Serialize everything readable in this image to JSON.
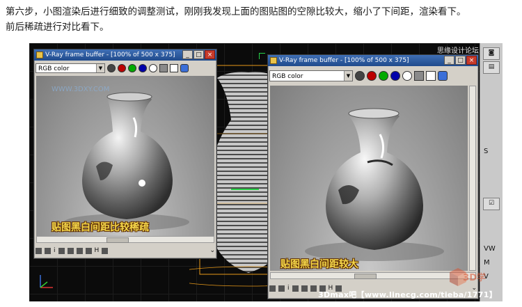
{
  "article": {
    "line1": "第六步，小图渲染后进行细致的调整测试，刚刚我发现上面的图贴图的空隙比较大，缩小了下间距，渲染看下。",
    "line2": "前后稀疏进行对比看下。"
  },
  "vray_left": {
    "title": "V-Ray frame buffer - [100% of 500 x 375]",
    "channel": "RGB color",
    "caption": "贴图黑白间距比较稀疏"
  },
  "vray_right": {
    "title": "V-Ray frame buffer - [100% of 500 x 375]",
    "channel": "RGB color",
    "caption": "贴图黑白间距较大"
  },
  "window_buttons": {
    "minimize": "_",
    "maximize": "□",
    "close": "×"
  },
  "bottom_toolbar": {
    "info": "i",
    "h_label": "H"
  },
  "side_panel": {
    "vw": "VW",
    "m": "M",
    "v": "V",
    "s": "S"
  },
  "watermarks": {
    "top_right": "思缘设计论坛",
    "site": "WWW.3DXY.COM",
    "logo_3d": "3D学",
    "bottom": "3Dmax吧【www.linecg.com/tieba/1771】"
  },
  "colors": {
    "title_bar": "#1f4a8c",
    "caption_fill": "#f5d74a",
    "close_button": "#c83a2a",
    "viewport_bg": "#0b0b0b"
  },
  "icons": [
    "window-icon",
    "red-channel-icon",
    "green-channel-icon",
    "blue-channel-icon",
    "white-dot-icon",
    "save-icon",
    "teapot-render-icon"
  ]
}
